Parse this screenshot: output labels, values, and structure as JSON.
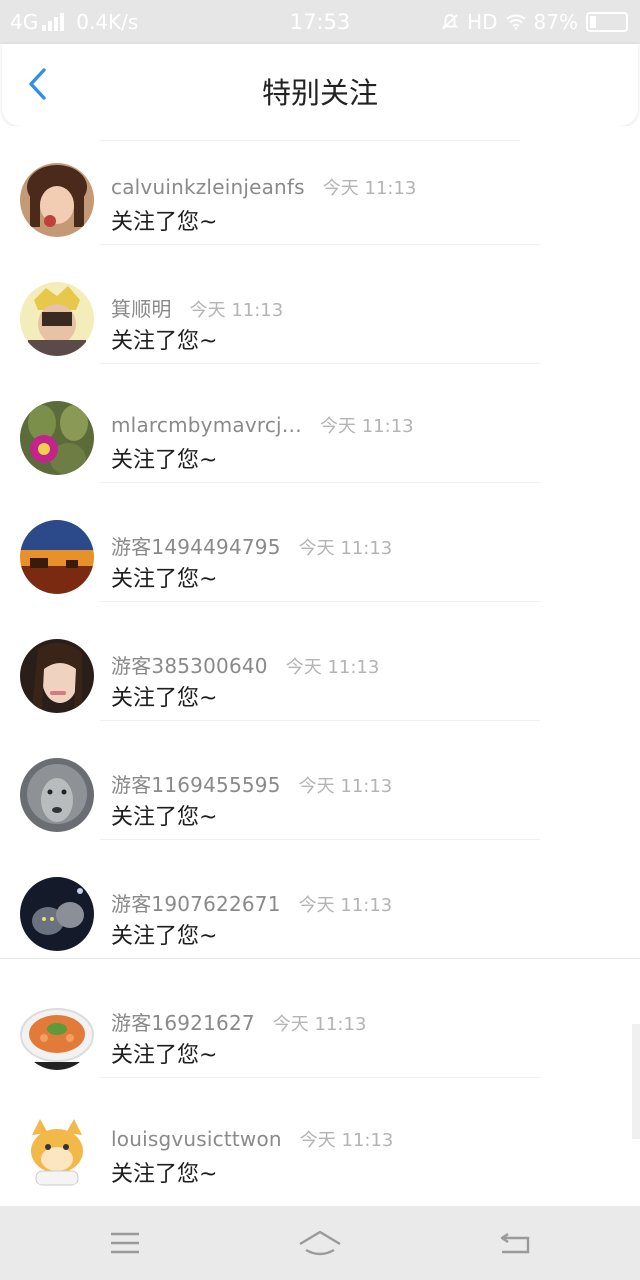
{
  "status_bar": {
    "network": "4G",
    "speed": "0.4K/s",
    "time": "17:53",
    "hd_label": "HD",
    "battery": "87%",
    "icons": [
      "signal-bars-icon",
      "mute-bell-icon",
      "wifi-icon",
      "battery-icon"
    ]
  },
  "header": {
    "title": "特别关注",
    "back_icon": "chevron-left-icon",
    "accent_color": "#2f8fe8"
  },
  "items": [
    {
      "username": "calvuinkzleinjeanfs",
      "time": "今天 11:13",
      "message": "关注了您~"
    },
    {
      "username": "箕顺明",
      "time": "今天 11:13",
      "message": "关注了您~"
    },
    {
      "username": "mlarcmbymavrcj…",
      "time": "今天 11:13",
      "message": "关注了您~"
    },
    {
      "username": "游客1494494795",
      "time": "今天 11:13",
      "message": "关注了您~"
    },
    {
      "username": "游客385300640",
      "time": "今天 11:13",
      "message": "关注了您~"
    },
    {
      "username": "游客1169455595",
      "time": "今天 11:13",
      "message": "关注了您~"
    },
    {
      "username": "游客1907622671",
      "time": "今天 11:13",
      "message": "关注了您~"
    },
    {
      "username": "游客16921627",
      "time": "今天 11:13",
      "message": "关注了您~"
    },
    {
      "username": "louisgvusicttwon",
      "time": "今天 11:13",
      "message": "关注了您~"
    }
  ],
  "bottom_nav": {
    "icons": [
      "menu-icon",
      "home-icon",
      "back-icon"
    ]
  }
}
